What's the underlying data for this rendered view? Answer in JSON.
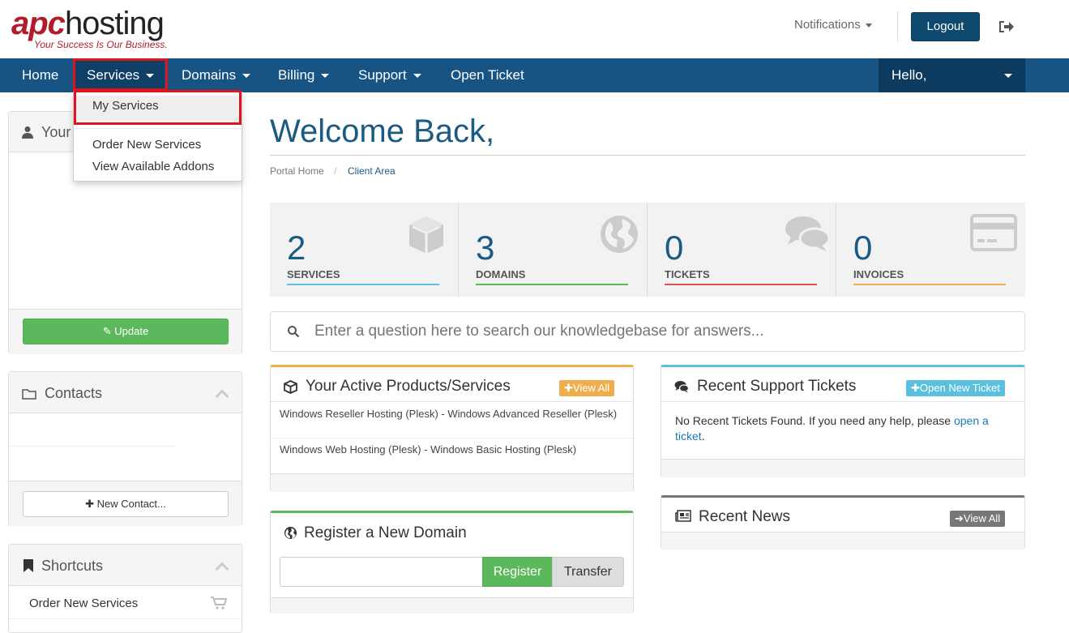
{
  "header": {
    "logo_brand": "apc",
    "logo_word": "hosting",
    "logo_tagline": "Your Success Is Our Business.",
    "notifications_label": "Notifications",
    "logout_label": "Logout"
  },
  "nav": {
    "items": [
      {
        "label": "Home"
      },
      {
        "label": "Services"
      },
      {
        "label": "Domains"
      },
      {
        "label": "Billing"
      },
      {
        "label": "Support"
      },
      {
        "label": "Open Ticket"
      }
    ],
    "user_greeting": "Hello,"
  },
  "services_dropdown": {
    "items": [
      {
        "label": "My Services"
      },
      {
        "label": "Order New Services"
      },
      {
        "label": "View Available Addons"
      }
    ]
  },
  "sidebar": {
    "your_info_title": "Your",
    "update_label": "Update",
    "contacts_title": "Contacts",
    "new_contact_label": "New Contact...",
    "shortcuts_title": "Shortcuts",
    "shortcuts_items": [
      {
        "label": "Order New Services"
      }
    ]
  },
  "main": {
    "welcome": "Welcome Back,",
    "breadcrumb": {
      "home": "Portal Home",
      "separator": "/",
      "current": "Client Area"
    },
    "tiles": [
      {
        "count": "2",
        "label": "SERVICES",
        "color": "#5bc0de",
        "icon": "cube-icon"
      },
      {
        "count": "3",
        "label": "DOMAINS",
        "color": "#5cb85c",
        "icon": "globe-icon"
      },
      {
        "count": "0",
        "label": "TICKETS",
        "color": "#d9534f",
        "icon": "comments-icon"
      },
      {
        "count": "0",
        "label": "INVOICES",
        "color": "#f0ad4e",
        "icon": "credit-card-icon"
      }
    ],
    "kb_search_placeholder": "Enter a question here to search our knowledgebase for answers...",
    "active_products": {
      "title": "Your Active Products/Services",
      "view_all": "View All",
      "items": [
        "Windows Reseller Hosting (Plesk) - Windows Advanced Reseller (Plesk)",
        "Windows Web Hosting (Plesk) - Windows Basic Hosting (Plesk)"
      ]
    },
    "register_domain": {
      "title": "Register a New Domain",
      "input_value": "",
      "register_label": "Register",
      "transfer_label": "Transfer"
    },
    "support_tickets": {
      "title": "Recent Support Tickets",
      "open_new_label": "Open New Ticket",
      "message": "No Recent Tickets Found. If you need any help, please ",
      "link_text": "open a ticket",
      "message_end": "."
    },
    "recent_news": {
      "title": "Recent News",
      "view_all": "View All"
    }
  },
  "colors": {
    "nav_bg": "#175483",
    "brand_dark": "#0e4a6f",
    "accent_green": "#5cb85c",
    "accent_orange": "#f0ad4e",
    "accent_blue": "#5bc0de",
    "accent_grey": "#777777",
    "highlight_red": "#e0141e"
  }
}
